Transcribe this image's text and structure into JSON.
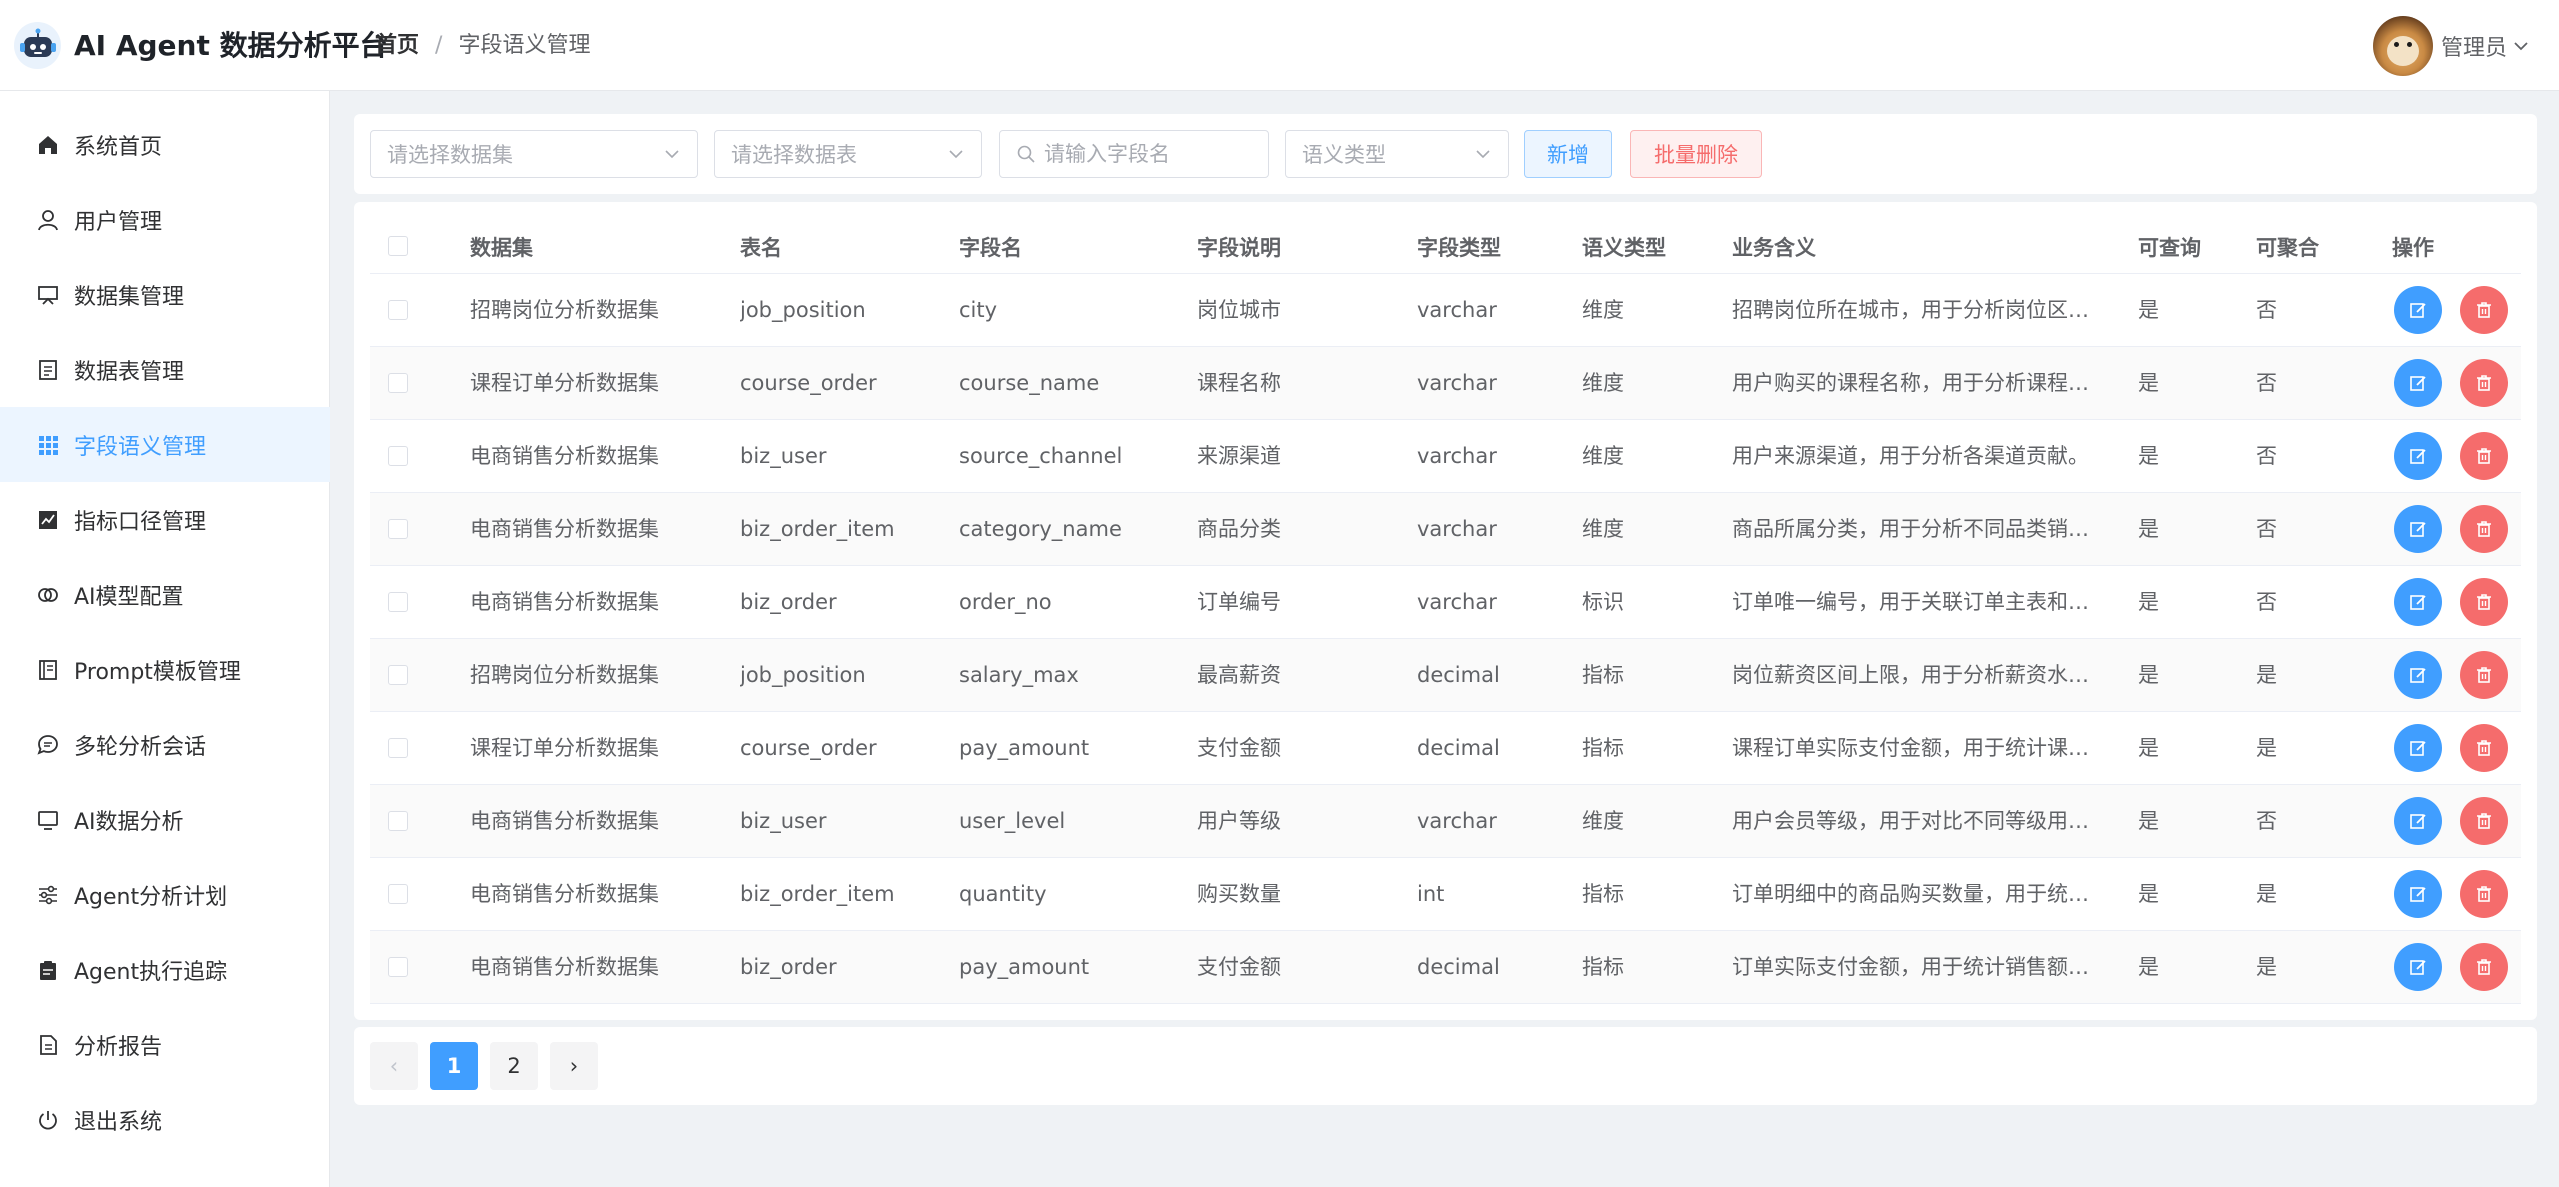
{
  "header": {
    "app_title": "AI Agent 数据分析平台",
    "breadcrumb_home": "首页",
    "breadcrumb_sep": "/",
    "breadcrumb_current": "字段语义管理",
    "user_name": "管理员"
  },
  "sidebar": {
    "items": [
      {
        "label": "系统首页",
        "icon": "home-icon"
      },
      {
        "label": "用户管理",
        "icon": "user-icon"
      },
      {
        "label": "数据集管理",
        "icon": "monitor-icon"
      },
      {
        "label": "数据表管理",
        "icon": "document-icon"
      },
      {
        "label": "字段语义管理",
        "icon": "grid-icon",
        "active": true
      },
      {
        "label": "指标口径管理",
        "icon": "chart-icon"
      },
      {
        "label": "AI模型配置",
        "icon": "connection-icon"
      },
      {
        "label": "Prompt模板管理",
        "icon": "notebook-icon"
      },
      {
        "label": "多轮分析会话",
        "icon": "chat-icon"
      },
      {
        "label": "AI数据分析",
        "icon": "screen-icon"
      },
      {
        "label": "Agent分析计划",
        "icon": "sliders-icon"
      },
      {
        "label": "Agent执行追踪",
        "icon": "clipboard-icon"
      },
      {
        "label": "分析报告",
        "icon": "report-icon"
      },
      {
        "label": "退出系统",
        "icon": "power-icon"
      }
    ]
  },
  "filters": {
    "dataset_placeholder": "请选择数据集",
    "table_placeholder": "请选择数据表",
    "field_placeholder": "请输入字段名",
    "semantic_placeholder": "语义类型",
    "add_label": "新增",
    "batch_delete_label": "批量删除"
  },
  "table": {
    "columns": [
      "数据集",
      "表名",
      "字段名",
      "字段说明",
      "字段类型",
      "语义类型",
      "业务含义",
      "可查询",
      "可聚合",
      "操作"
    ],
    "rows": [
      [
        "招聘岗位分析数据集",
        "job_position",
        "city",
        "岗位城市",
        "varchar",
        "维度",
        "招聘岗位所在城市，用于分析岗位区…",
        "是",
        "否"
      ],
      [
        "课程订单分析数据集",
        "course_order",
        "course_name",
        "课程名称",
        "varchar",
        "维度",
        "用户购买的课程名称，用于分析课程…",
        "是",
        "否"
      ],
      [
        "电商销售分析数据集",
        "biz_user",
        "source_channel",
        "来源渠道",
        "varchar",
        "维度",
        "用户来源渠道，用于分析各渠道贡献。",
        "是",
        "否"
      ],
      [
        "电商销售分析数据集",
        "biz_order_item",
        "category_name",
        "商品分类",
        "varchar",
        "维度",
        "商品所属分类，用于分析不同品类销…",
        "是",
        "否"
      ],
      [
        "电商销售分析数据集",
        "biz_order",
        "order_no",
        "订单编号",
        "varchar",
        "标识",
        "订单唯一编号，用于关联订单主表和…",
        "是",
        "否"
      ],
      [
        "招聘岗位分析数据集",
        "job_position",
        "salary_max",
        "最高薪资",
        "decimal",
        "指标",
        "岗位薪资区间上限，用于分析薪资水…",
        "是",
        "是"
      ],
      [
        "课程订单分析数据集",
        "course_order",
        "pay_amount",
        "支付金额",
        "decimal",
        "指标",
        "课程订单实际支付金额，用于统计课…",
        "是",
        "是"
      ],
      [
        "电商销售分析数据集",
        "biz_user",
        "user_level",
        "用户等级",
        "varchar",
        "维度",
        "用户会员等级，用于对比不同等级用…",
        "是",
        "否"
      ],
      [
        "电商销售分析数据集",
        "biz_order_item",
        "quantity",
        "购买数量",
        "int",
        "指标",
        "订单明细中的商品购买数量，用于统…",
        "是",
        "是"
      ],
      [
        "电商销售分析数据集",
        "biz_order",
        "pay_amount",
        "支付金额",
        "decimal",
        "指标",
        "订单实际支付金额，用于统计销售额…",
        "是",
        "是"
      ]
    ]
  },
  "pagination": {
    "prev": "‹",
    "pages": [
      "1",
      "2"
    ],
    "current": "1",
    "next": "›"
  }
}
